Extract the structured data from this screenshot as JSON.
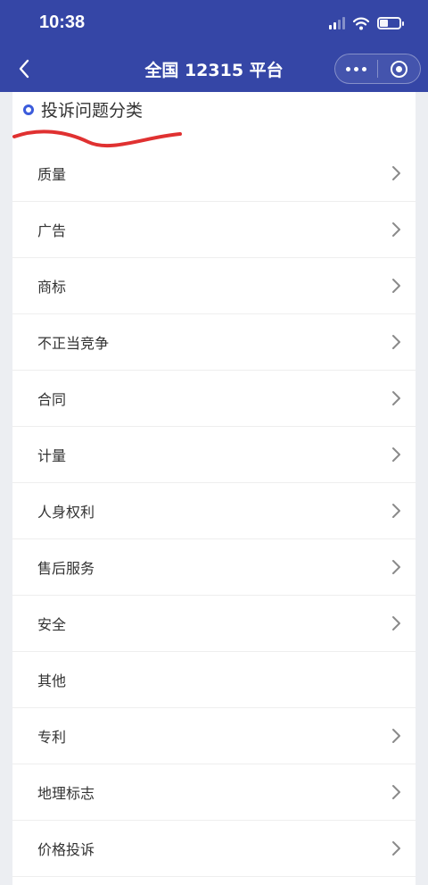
{
  "status_bar": {
    "time": "10:38"
  },
  "nav": {
    "title": "全国 12315 平台"
  },
  "section": {
    "title": "投诉问题分类"
  },
  "categories": [
    {
      "label": "质量",
      "has_arrow": true
    },
    {
      "label": "广告",
      "has_arrow": true
    },
    {
      "label": "商标",
      "has_arrow": true
    },
    {
      "label": "不正当竞争",
      "has_arrow": true
    },
    {
      "label": "合同",
      "has_arrow": true
    },
    {
      "label": "计量",
      "has_arrow": true
    },
    {
      "label": "人身权利",
      "has_arrow": true
    },
    {
      "label": "售后服务",
      "has_arrow": true
    },
    {
      "label": "安全",
      "has_arrow": true
    },
    {
      "label": "其他",
      "has_arrow": false
    },
    {
      "label": "专利",
      "has_arrow": true
    },
    {
      "label": "地理标志",
      "has_arrow": true
    },
    {
      "label": "价格投诉",
      "has_arrow": true
    }
  ],
  "colors": {
    "header": "#3546a6",
    "accent": "#3b5bdb",
    "annotation": "#e03131"
  },
  "icons": [
    "back-icon",
    "more-icon",
    "close-mini-program-icon",
    "chevron-right-icon",
    "wifi-icon",
    "battery-icon",
    "signal-icon"
  ]
}
